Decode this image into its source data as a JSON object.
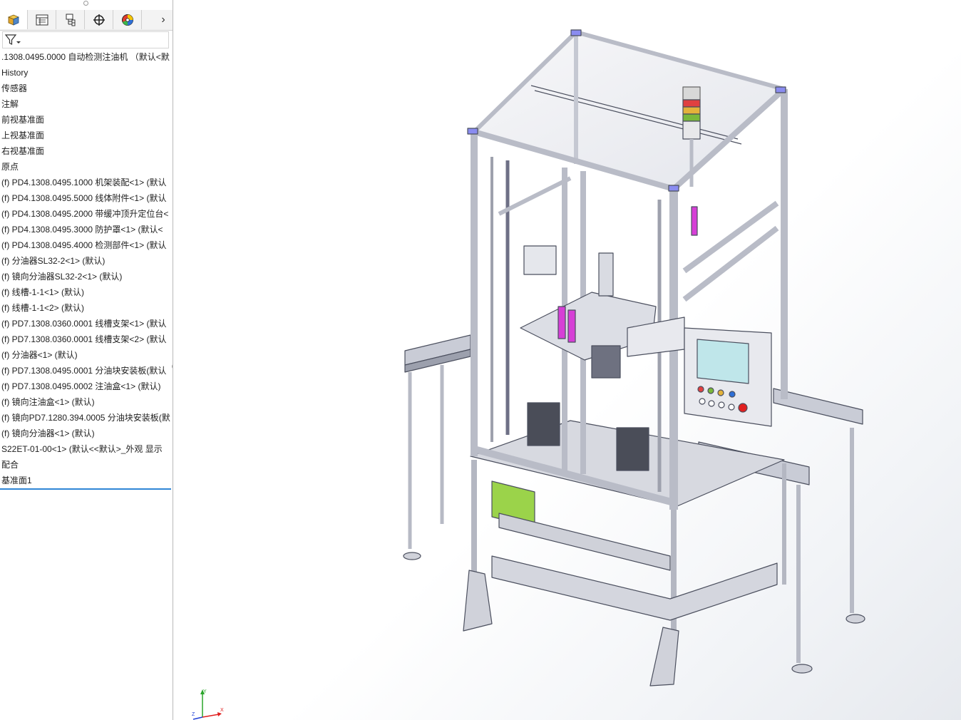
{
  "feature_manager": {
    "tabs": [
      {
        "name": "featuremanager-tab",
        "icon": "part-icon"
      },
      {
        "name": "propertymanager-tab",
        "icon": "property-list-icon"
      },
      {
        "name": "configurationmanager-tab",
        "icon": "configuration-icon"
      },
      {
        "name": "dimxpert-tab",
        "icon": "crosshair-icon"
      },
      {
        "name": "display-manager-tab",
        "icon": "appearance-pie-icon"
      }
    ],
    "more_tabs_glyph": "›",
    "filter_icon": "funnel-filter-icon",
    "tree_items": [
      ".1308.0495.0000 自动检测注油机 （默认<默",
      "History",
      "传感器",
      "注解",
      "前视基准面",
      "上视基准面",
      "右视基准面",
      "原点",
      "(f) PD4.1308.0495.1000 机架装配<1> (默认",
      "(f) PD4.1308.0495.5000 线体附件<1> (默认",
      "(f) PD4.1308.0495.2000 带缓冲顶升定位台<",
      "(f) PD4.1308.0495.3000 防护罩<1> (默认<",
      "(f) PD4.1308.0495.4000 检测部件<1> (默认",
      "(f) 分油器SL32-2<1> (默认)",
      "(f) 镜向分油器SL32-2<1> (默认)",
      "(f) 线槽-1-1<1> (默认)",
      "(f) 线槽-1-1<2> (默认)",
      "(f) PD7.1308.0360.0001 线槽支架<1> (默认",
      "(f) PD7.1308.0360.0001 线槽支架<2> (默认",
      "(f) 分油器<1> (默认)",
      "(f) PD7.1308.0495.0001 分油块安装板(默认",
      "(f) PD7.1308.0495.0002 注油盒<1> (默认)",
      "(f) 镜向注油盒<1> (默认)",
      "(f) 镜向PD7.1280.394.0005 分油块安装板(默",
      "(f) 镜向分油器<1> (默认)",
      "S22ET-01-00<1> (默认<<默认>_外观 显示",
      "配合",
      "基准面1"
    ]
  },
  "viewport": {
    "model_image": "automatic-oil-injection-machine-3d-model",
    "triad_labels": {
      "y": "Y",
      "x": "X",
      "z": "Z"
    },
    "colors": {
      "frame": "#c9ccd6",
      "frame_dark": "#5a5e6e",
      "corner_caps": "#8a8cf0",
      "green_panel": "#9bd34a",
      "magenta": "#d63fd6",
      "screen": "#bfe6ea"
    }
  }
}
